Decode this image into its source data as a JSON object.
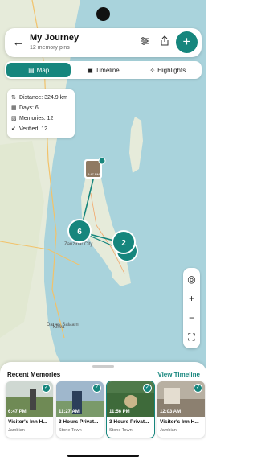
{
  "header": {
    "title": "My Journey",
    "subtitle": "12 memory pins"
  },
  "tabs": [
    {
      "label": "Map",
      "active": true
    },
    {
      "label": "Timeline",
      "active": false
    },
    {
      "label": "Highlights",
      "active": false
    }
  ],
  "stats": {
    "distance": "Distance: 324.9 km",
    "days": "Days: 6",
    "memories": "Memories: 12",
    "verified": "Verified: 12"
  },
  "map": {
    "clusters": [
      {
        "count": "6"
      },
      {
        "count": "2"
      }
    ],
    "photo_pin_time": "3:47 PM",
    "labels": {
      "city": "Zanzibar City",
      "region": "Kilwa",
      "coast": "Dar es Salaam"
    }
  },
  "recent": {
    "title": "Recent Memories",
    "view_all": "View Timeline",
    "items": [
      {
        "time": "6:47 PM",
        "name": "Visitor's Inn H...",
        "location": "Jambian"
      },
      {
        "time": "11:27 AM",
        "name": "3 Hours Privat...",
        "location": "Stone Town"
      },
      {
        "time": "11:56 PM",
        "name": "3 Hours Privat...",
        "location": "Stone Town",
        "selected": true
      },
      {
        "time": "12:03 AM",
        "name": "Visitor's Inn H...",
        "location": "Jambian"
      }
    ]
  },
  "colors": {
    "accent": "#16867d",
    "sea": "#a9d3dc",
    "land": "#e8ecdd"
  }
}
